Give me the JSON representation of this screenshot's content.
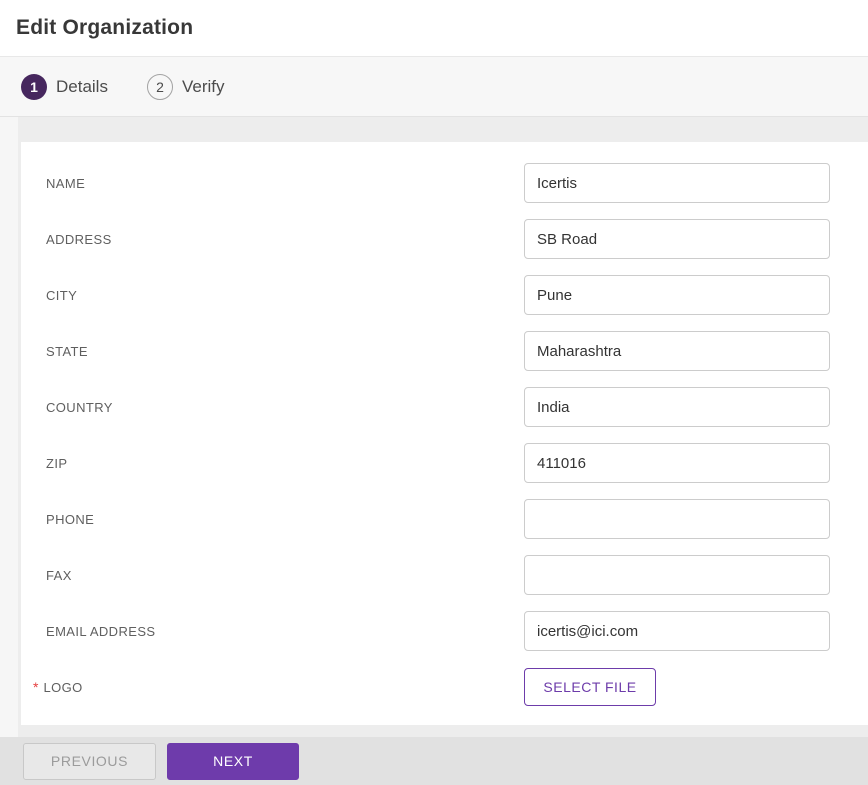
{
  "header": {
    "title": "Edit Organization"
  },
  "stepper": {
    "steps": [
      {
        "number": "1",
        "label": "Details",
        "active": true
      },
      {
        "number": "2",
        "label": "Verify",
        "active": false
      }
    ]
  },
  "form": {
    "fields": [
      {
        "label": "NAME",
        "value": "Icertis",
        "required": false,
        "type": "text"
      },
      {
        "label": "ADDRESS",
        "value": "SB Road",
        "required": false,
        "type": "text"
      },
      {
        "label": "CITY",
        "value": "Pune",
        "required": false,
        "type": "text"
      },
      {
        "label": "STATE",
        "value": "Maharashtra",
        "required": false,
        "type": "text"
      },
      {
        "label": "COUNTRY",
        "value": "India",
        "required": false,
        "type": "text"
      },
      {
        "label": "ZIP",
        "value": "411016",
        "required": false,
        "type": "text"
      },
      {
        "label": "PHONE",
        "value": "",
        "required": false,
        "type": "text"
      },
      {
        "label": "FAX",
        "value": "",
        "required": false,
        "type": "text"
      },
      {
        "label": "EMAIL ADDRESS",
        "value": "icertis@ici.com",
        "required": false,
        "type": "text"
      },
      {
        "label": "LOGO",
        "value": "",
        "required": true,
        "type": "file",
        "button_label": "SELECT FILE"
      }
    ],
    "required_marker": "*"
  },
  "footer": {
    "previous_label": "PREVIOUS",
    "next_label": "NEXT"
  },
  "colors": {
    "accent_purple": "#6e3bab",
    "step_active_purple": "#46275e",
    "required_red": "#e53e3e",
    "footer_gray": "#e1e1e1"
  }
}
